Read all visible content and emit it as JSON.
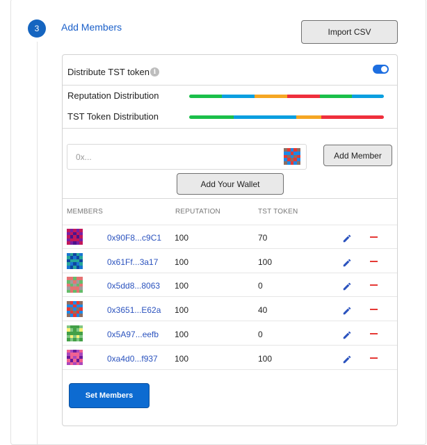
{
  "step": {
    "number": "3",
    "title": "Add Members"
  },
  "import_csv_label": "Import CSV",
  "distribute": {
    "label": "Distribute TST token",
    "info_icon": "info-icon",
    "enabled": true
  },
  "distribution": [
    {
      "label": "Reputation Distribution",
      "segments": [
        {
          "color": "#1bbf4a",
          "share": 0.168
        },
        {
          "color": "#0a9fe0",
          "share": 0.168
        },
        {
          "color": "#f5a623",
          "share": 0.168
        },
        {
          "color": "#ef2f3c",
          "share": 0.168
        },
        {
          "color": "#1bbf4a",
          "share": 0.164
        },
        {
          "color": "#0a9fe0",
          "share": 0.164
        }
      ]
    },
    {
      "label": "TST Token Distribution",
      "segments": [
        {
          "color": "#1bbf4a",
          "share": 0.227
        },
        {
          "color": "#0a9fe0",
          "share": 0.322
        },
        {
          "color": "#f5a623",
          "share": 0.129
        },
        {
          "color": "#ef2f3c",
          "share": 0.322
        }
      ]
    }
  ],
  "address_input": {
    "placeholder": "0x...",
    "value": ""
  },
  "add_member_label": "Add Member",
  "add_wallet_label": "Add Your Wallet",
  "table": {
    "headers": {
      "members": "MEMBERS",
      "reputation": "REPUTATION",
      "token": "TST TOKEN"
    },
    "rows": [
      {
        "address": "0x90F8...c9C1",
        "reputation": "100",
        "token": "70"
      },
      {
        "address": "0x61Ff...3a17",
        "reputation": "100",
        "token": "100"
      },
      {
        "address": "0x5dd8...8063",
        "reputation": "100",
        "token": "0"
      },
      {
        "address": "0x3651...E62a",
        "reputation": "100",
        "token": "40"
      },
      {
        "address": "0x5A97...eefb",
        "reputation": "100",
        "token": "0"
      },
      {
        "address": "0xa4d0...f937",
        "reputation": "100",
        "token": "100"
      }
    ]
  },
  "set_members_label": "Set Members",
  "colors": {
    "accent": "#1565c0",
    "link": "#2a52be",
    "remove": "#e53935",
    "toggle": "#1d6ee0"
  }
}
